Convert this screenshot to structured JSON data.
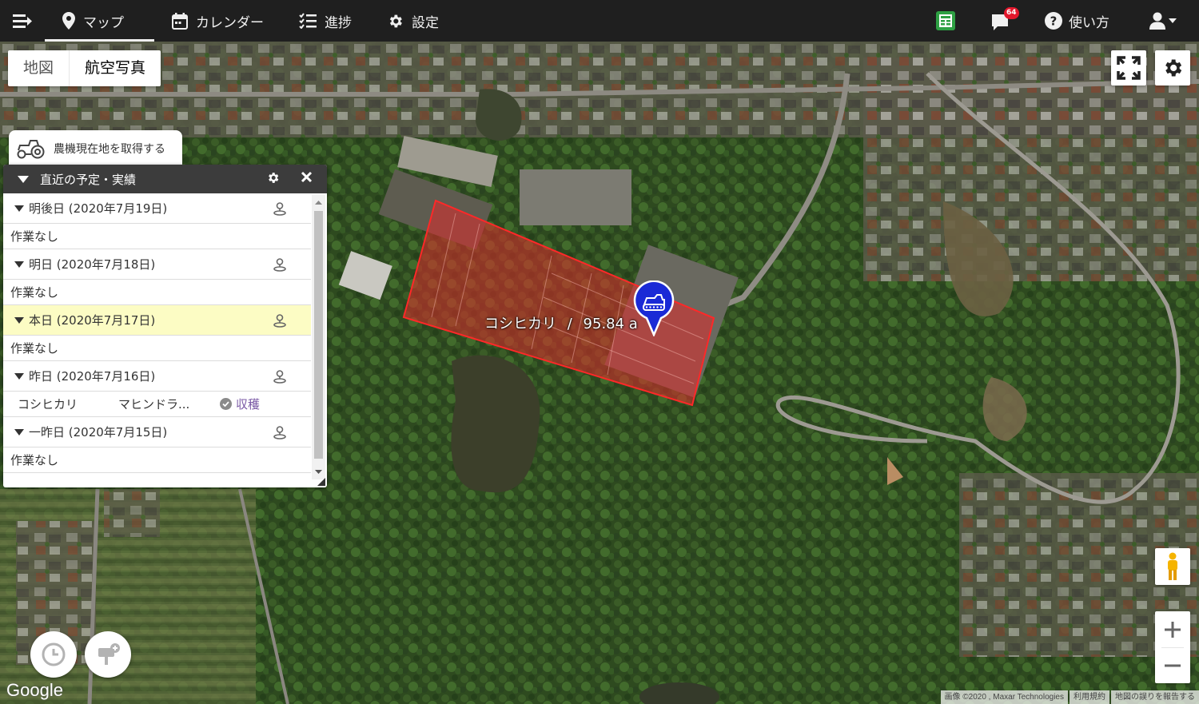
{
  "nav": {
    "items": [
      {
        "label": "マップ",
        "icon": "map-pin-icon",
        "active": true
      },
      {
        "label": "カレンダー",
        "icon": "calendar-icon",
        "active": false
      },
      {
        "label": "進捗",
        "icon": "checklist-icon",
        "active": false
      },
      {
        "label": "設定",
        "icon": "gear-icon",
        "active": false
      }
    ],
    "notification_count": "64",
    "help_label": "使い方"
  },
  "map": {
    "map_type": {
      "map": "地図",
      "satellite": "航空写真",
      "selected": "航空写真"
    },
    "machine_location_label": "農機現在地を取得する",
    "field_label": {
      "crop": "コシヒカリ",
      "separator": "/",
      "area": "95.84 a"
    },
    "field_color": "#e02b2b",
    "marker_color": "#1a2ad6",
    "google_label": "Google",
    "attribution": {
      "imagery": "画像 ©2020 , Maxar Technologies",
      "terms": "利用規約",
      "report": "地図の誤りを報告する"
    }
  },
  "panel": {
    "title": "直近の予定・実績",
    "days": [
      {
        "label": "明後日 (2020年7月19日)",
        "today": false,
        "tasks": [],
        "empty_label": "作業なし"
      },
      {
        "label": "明日 (2020年7月18日)",
        "today": false,
        "tasks": [],
        "empty_label": "作業なし"
      },
      {
        "label": "本日 (2020年7月17日)",
        "today": true,
        "tasks": [],
        "empty_label": "作業なし"
      },
      {
        "label": "昨日 (2020年7月16日)",
        "today": false,
        "tasks": [
          {
            "crop": "コシヒカリ",
            "machine": "マヒンドラ...",
            "status": "収穫"
          }
        ],
        "empty_label": ""
      },
      {
        "label": "一昨日 (2020年7月15日)",
        "today": false,
        "tasks": [],
        "empty_label": "作業なし"
      }
    ]
  },
  "colors": {
    "navbar": "#1f1f1f",
    "today_highlight": "#fcfcc4",
    "status_done": "#7b5aa6",
    "badge": "#e3172c"
  }
}
